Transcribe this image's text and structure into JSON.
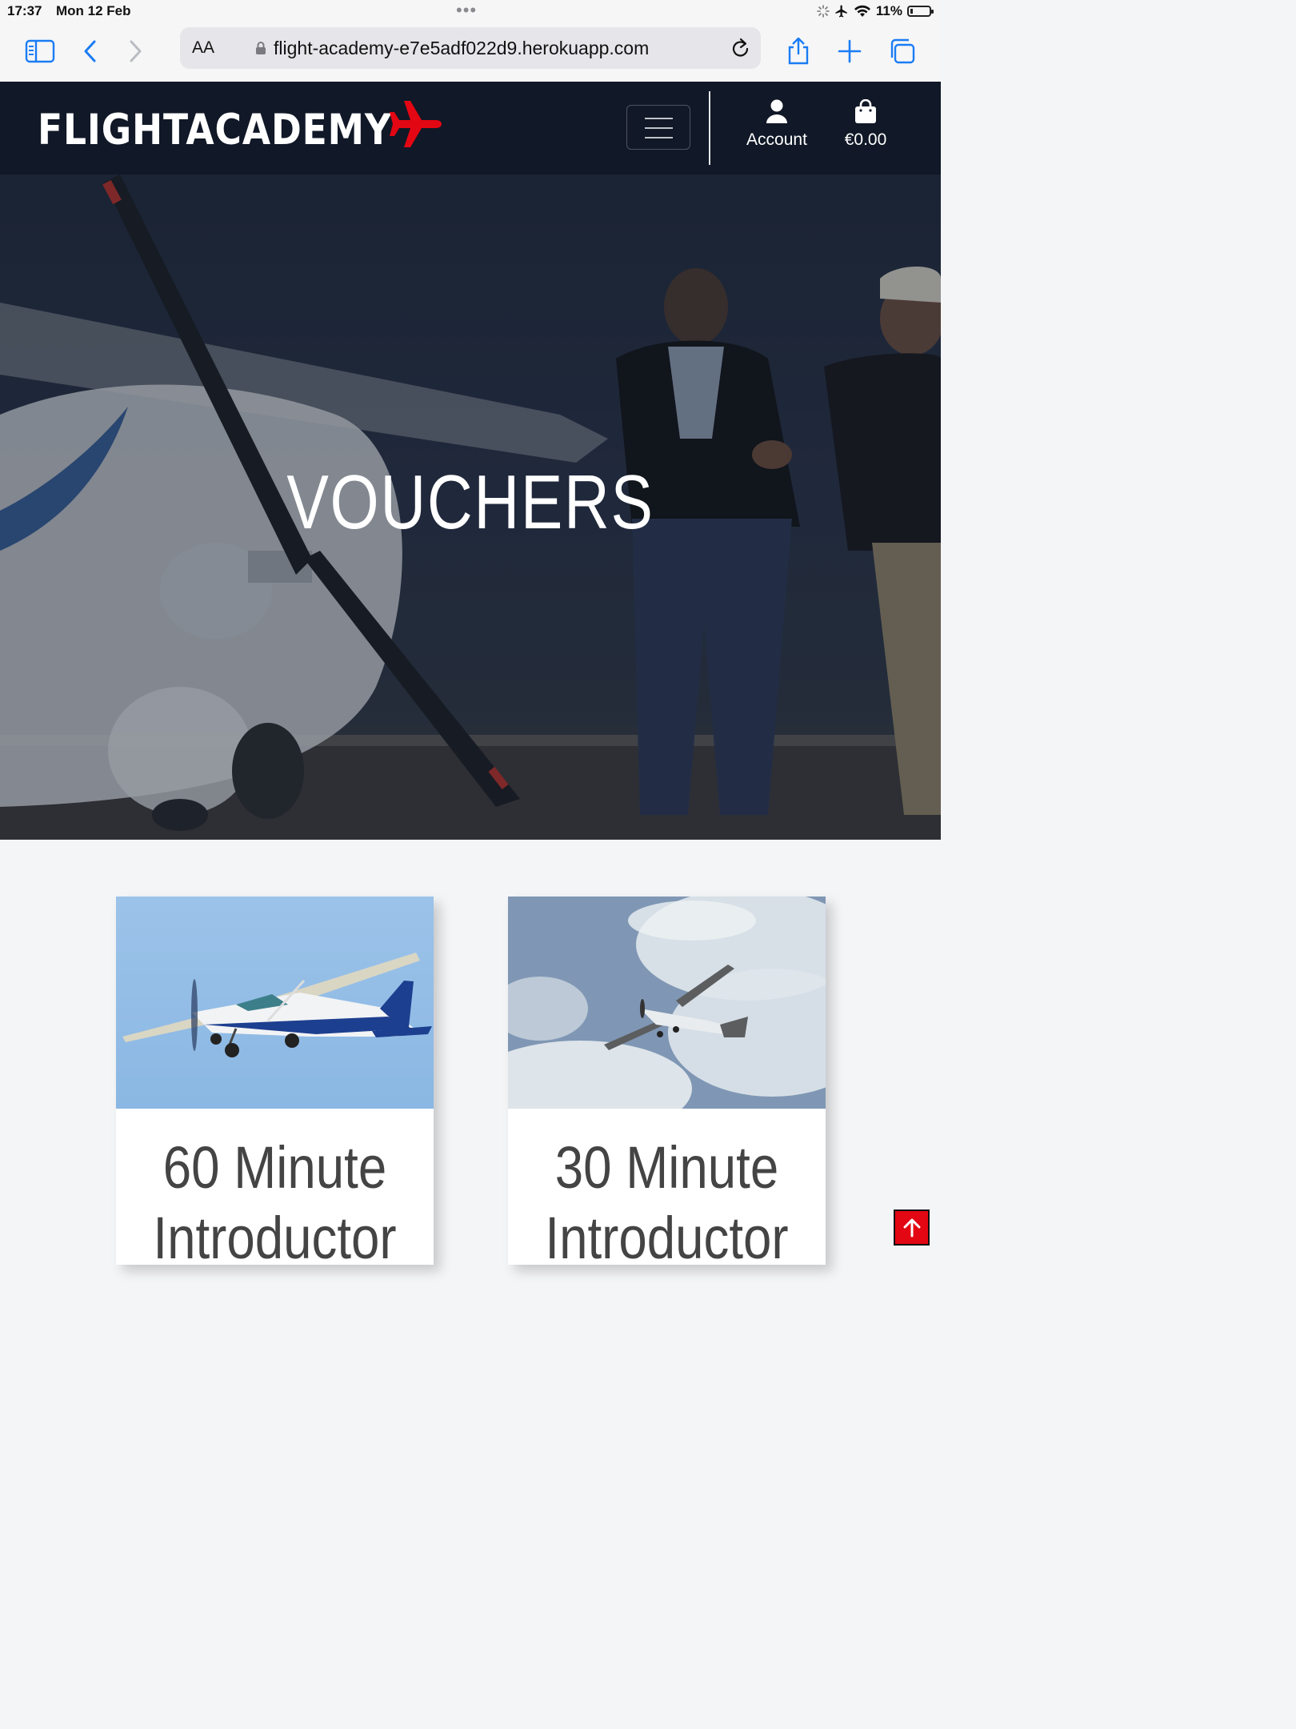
{
  "status_bar": {
    "time": "17:37",
    "date": "Mon 12 Feb",
    "battery": "11%",
    "icons": [
      "loading-icon",
      "airplane-mode-icon",
      "wifi-icon",
      "battery-icon"
    ]
  },
  "browser": {
    "aa_label": "AA",
    "url": "flight-academy-e7e5adf022d9.herokuapp.com",
    "icons": [
      "sidebar-icon",
      "back-icon",
      "forward-icon",
      "lock-icon",
      "reload-icon",
      "share-icon",
      "new-tab-icon",
      "tabs-icon"
    ]
  },
  "nav": {
    "logo": "FLIGHTACADEMY",
    "account_label": "Account",
    "bag_total": "€0.00",
    "accent_color": "#e30613",
    "background": "#111827"
  },
  "hero": {
    "title": "VOUCHERS"
  },
  "cards": [
    {
      "title_line1": "60 Minute",
      "title_line2": "Introductor"
    },
    {
      "title_line1": "30 Minute",
      "title_line2": "Introductor"
    }
  ]
}
